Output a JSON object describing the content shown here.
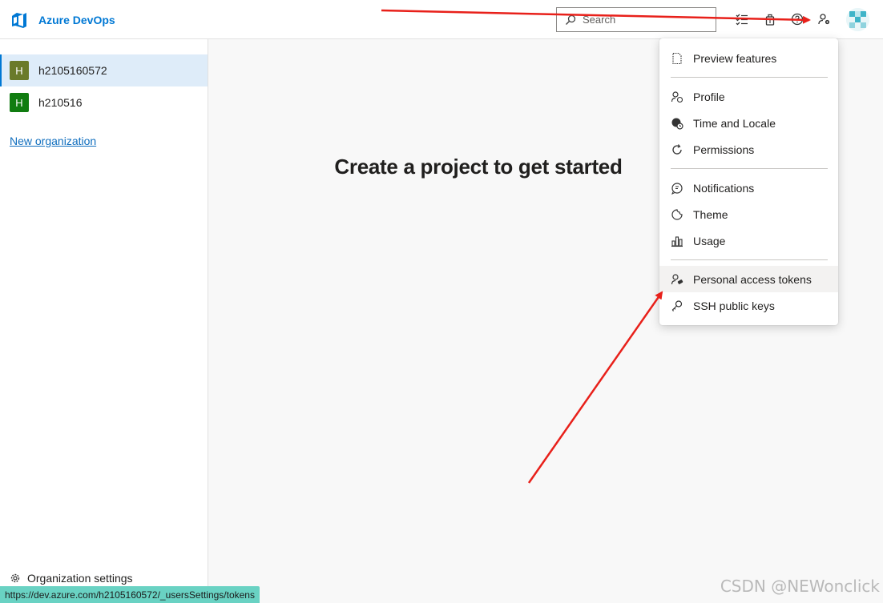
{
  "app": {
    "brand_name": "Azure DevOps"
  },
  "header": {
    "search_placeholder": "Search",
    "icons": [
      "task-list-icon",
      "marketplace-bag-icon",
      "help-icon",
      "user-settings-icon"
    ]
  },
  "sidebar": {
    "organizations": [
      {
        "initial": "H",
        "name": "h2105160572",
        "color": "#6a7a2a",
        "selected": true
      },
      {
        "initial": "H",
        "name": "h210516",
        "color": "#107c10",
        "selected": false
      }
    ],
    "new_org_label": "New organization",
    "settings_label": "Organization settings"
  },
  "main": {
    "title": "Create a project to get started"
  },
  "user_menu": {
    "items": [
      {
        "label": "Preview features",
        "icon": "document-icon"
      },
      {
        "label": "Profile",
        "icon": "profile-icon"
      },
      {
        "label": "Time and Locale",
        "icon": "globe-clock-icon"
      },
      {
        "label": "Permissions",
        "icon": "refresh-icon"
      },
      {
        "label": "Notifications",
        "icon": "notification-icon"
      },
      {
        "label": "Theme",
        "icon": "theme-icon"
      },
      {
        "label": "Usage",
        "icon": "bar-chart-icon"
      },
      {
        "label": "Personal access tokens",
        "icon": "person-key-icon"
      },
      {
        "label": "SSH public keys",
        "icon": "key-icon"
      }
    ],
    "highlighted_item": "Personal access tokens"
  },
  "status_bar": {
    "url": "https://dev.azure.com/h2105160572/_usersSettings/tokens"
  },
  "watermark": {
    "text": "CSDN @NEWonclick"
  },
  "colors": {
    "accent": "#0078d4",
    "annotation_arrow": "#e8201a",
    "status_bar_bg": "#69d2c3"
  }
}
